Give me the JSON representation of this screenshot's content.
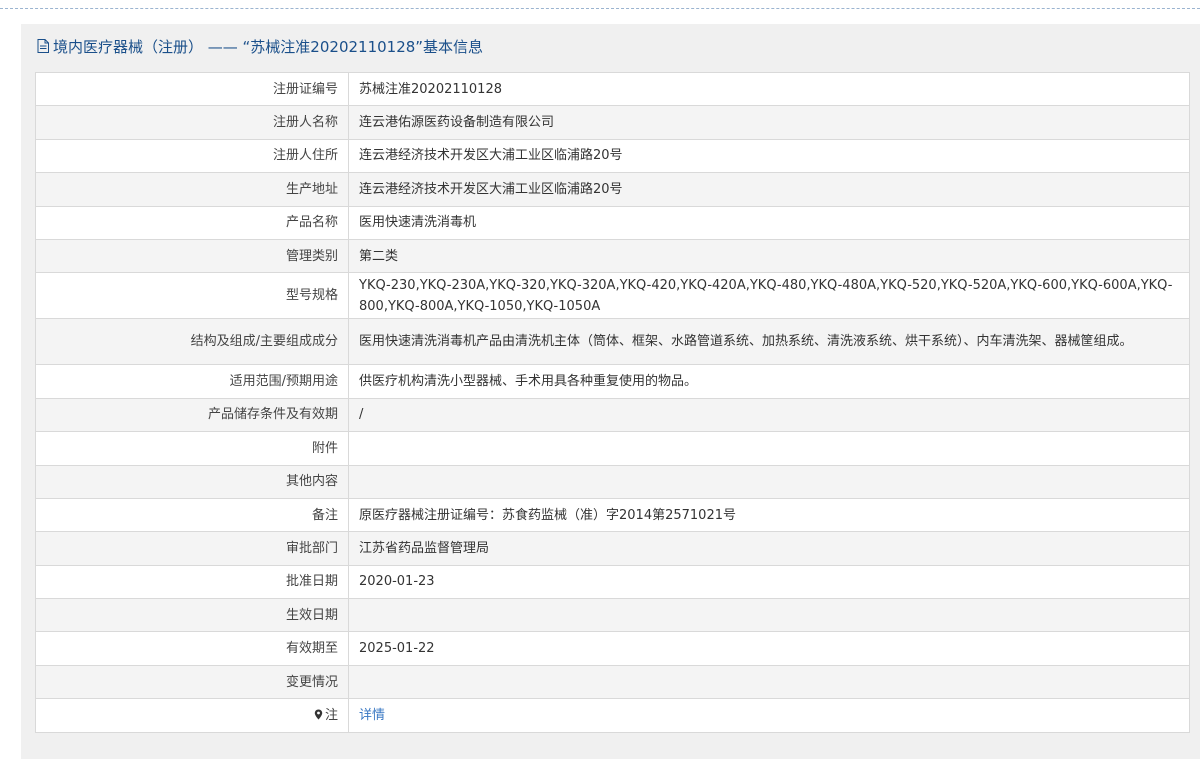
{
  "header": {
    "title": "境内医疗器械（注册） —— “苏械注准20202110128”基本信息"
  },
  "rows": [
    {
      "label": "注册证编号",
      "value": "苏械注准20202110128"
    },
    {
      "label": "注册人名称",
      "value": "连云港佑源医药设备制造有限公司"
    },
    {
      "label": "注册人住所",
      "value": "连云港经济技术开发区大浦工业区临浦路20号"
    },
    {
      "label": "生产地址",
      "value": "连云港经济技术开发区大浦工业区临浦路20号"
    },
    {
      "label": "产品名称",
      "value": "医用快速清洗消毒机"
    },
    {
      "label": "管理类别",
      "value": "第二类"
    },
    {
      "label": "型号规格",
      "value": "YKQ-230,YKQ-230A,YKQ-320,YKQ-320A,YKQ-420,YKQ-420A,YKQ-480,YKQ-480A,YKQ-520,YKQ-520A,YKQ-600,YKQ-600A,YKQ-800,YKQ-800A,YKQ-1050,YKQ-1050A"
    },
    {
      "label": "结构及组成/主要组成成分",
      "value": "医用快速清洗消毒机产品由清洗机主体（筒体、框架、水路管道系统、加热系统、清洗液系统、烘干系统）、内车清洗架、器械筐组成。"
    },
    {
      "label": "适用范围/预期用途",
      "value": "供医疗机构清洗小型器械、手术用具各种重复使用的物品。"
    },
    {
      "label": "产品储存条件及有效期",
      "value": "/"
    },
    {
      "label": "附件",
      "value": ""
    },
    {
      "label": "其他内容",
      "value": ""
    },
    {
      "label": "备注",
      "value": "原医疗器械注册证编号：苏食药监械（准）字2014第2571021号"
    },
    {
      "label": "审批部门",
      "value": "江苏省药品监督管理局"
    },
    {
      "label": "批准日期",
      "value": "2020-01-23"
    },
    {
      "label": "生效日期",
      "value": ""
    },
    {
      "label": "有效期至",
      "value": "2025-01-22"
    },
    {
      "label": "变更情况",
      "value": ""
    }
  ],
  "note": {
    "label": "注",
    "icon": "pin-icon",
    "link_text": "详情"
  },
  "colors": {
    "header_text": "#1a4f8a",
    "link": "#3a78c3",
    "panel_bg": "#f0f0f0"
  }
}
